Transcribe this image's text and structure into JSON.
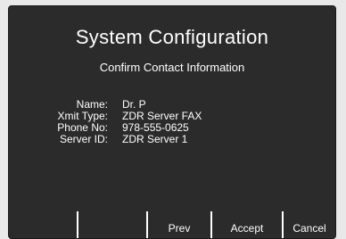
{
  "screen": {
    "title": "System Configuration",
    "subtitle": "Confirm Contact Information"
  },
  "contact": {
    "name_label": "Name:",
    "name_value": "Dr. P",
    "xmit_label": "Xmit Type:",
    "xmit_value": "ZDR Server FAX",
    "phone_label": "Phone No:",
    "phone_value": "978-555-0625",
    "server_label": "Server ID:",
    "server_value": "ZDR Server 1"
  },
  "softkeys": {
    "key1": "",
    "key2": "",
    "key3": "Prev",
    "key4": "Accept",
    "key5": "Cancel"
  }
}
